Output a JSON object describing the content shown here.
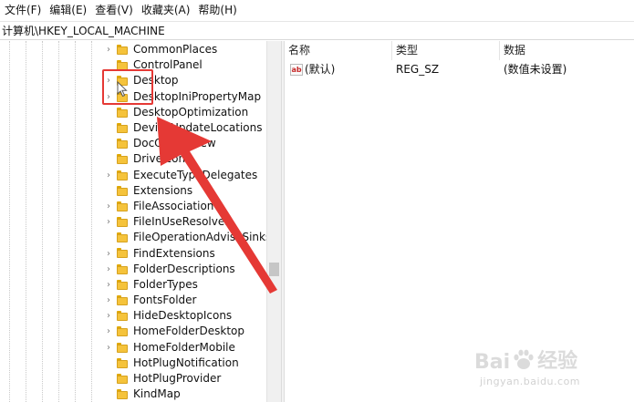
{
  "menubar": {
    "items": [
      "文件(F)",
      "编辑(E)",
      "查看(V)",
      "收藏夹(A)",
      "帮助(H)"
    ]
  },
  "address": {
    "path": "计算机\\HKEY_LOCAL_MACHINE"
  },
  "tree": {
    "nodes": [
      {
        "label": "CommonPlaces",
        "expander": "›"
      },
      {
        "label": "ControlPanel",
        "expander": ""
      },
      {
        "label": "Desktop",
        "expander": "›"
      },
      {
        "label": "DesktopIniPropertyMap",
        "expander": "›"
      },
      {
        "label": "DesktopOptimization",
        "expander": ""
      },
      {
        "label": "DeviceUpdateLocations",
        "expander": ""
      },
      {
        "label": "DocObjectView",
        "expander": ""
      },
      {
        "label": "DriveIcons",
        "expander": ""
      },
      {
        "label": "ExecuteTypeDelegates",
        "expander": "›"
      },
      {
        "label": "Extensions",
        "expander": ""
      },
      {
        "label": "FileAssociation",
        "expander": "›"
      },
      {
        "label": "FileInUseResolver",
        "expander": "›"
      },
      {
        "label": "FileOperationAdviseSinks",
        "expander": ""
      },
      {
        "label": "FindExtensions",
        "expander": "›"
      },
      {
        "label": "FolderDescriptions",
        "expander": "›"
      },
      {
        "label": "FolderTypes",
        "expander": "›"
      },
      {
        "label": "FontsFolder",
        "expander": "›"
      },
      {
        "label": "HideDesktopIcons",
        "expander": "›"
      },
      {
        "label": "HomeFolderDesktop",
        "expander": "›"
      },
      {
        "label": "HomeFolderMobile",
        "expander": "›"
      },
      {
        "label": "HotPlugNotification",
        "expander": ""
      },
      {
        "label": "HotPlugProvider",
        "expander": ""
      },
      {
        "label": "KindMap",
        "expander": ""
      }
    ]
  },
  "list": {
    "headers": {
      "name": "名称",
      "type": "类型",
      "data": "数据"
    },
    "rows": [
      {
        "icon_text": "ab",
        "name": "(默认)",
        "type": "REG_SZ",
        "data": "(数值未设置)"
      }
    ]
  },
  "watermark": {
    "brand": "Bai",
    "brand2": "经验",
    "url": "jingyan.baidu.com"
  },
  "colors": {
    "highlight": "#e53935",
    "arrow": "#e53935",
    "folder": "#f5c33b"
  },
  "icons": {
    "folder": "folder-icon",
    "value": "string-value-icon",
    "expander": "chevron-right-icon",
    "cursor": "mouse-pointer-icon"
  }
}
